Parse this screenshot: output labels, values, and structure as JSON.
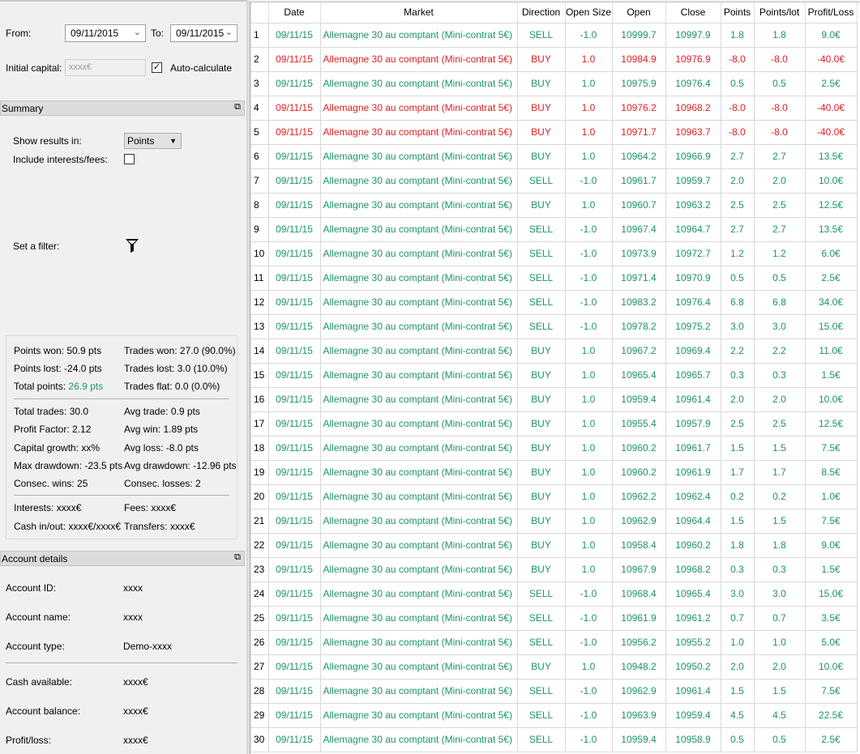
{
  "filters": {
    "from_label": "From:",
    "from_value": "09/11/2015",
    "to_label": "To:",
    "to_value": "09/11/2015",
    "initial_capital_label": "Initial capital:",
    "initial_capital_value": "xxxx€",
    "auto_calc_label": "Auto-calculate",
    "auto_calc_checked": true
  },
  "summary": {
    "title": "Summary",
    "show_results_label": "Show results in:",
    "show_results_value": "Points",
    "include_fees_label": "Include interests/fees:",
    "filter_label": "Set a filter:",
    "stats": {
      "points_won": "Points won: 50.9 pts",
      "trades_won": "Trades won: 27.0 (90.0%)",
      "points_lost": "Points lost: -24.0 pts",
      "trades_lost": "Trades lost: 3.0 (10.0%)",
      "total_points_label": "Total points:",
      "total_points_value": "26.9 pts",
      "trades_flat": "Trades flat: 0.0 (0.0%)",
      "total_trades": "Total trades: 30.0",
      "avg_trade": "Avg trade: 0.9 pts",
      "profit_factor": "Profit Factor: 2.12",
      "avg_win": "Avg win: 1.89 pts",
      "capital_growth": "Capital growth: xx%",
      "avg_loss": "Avg loss: -8.0 pts",
      "max_drawdown": "Max drawdown: -23.5 pts",
      "avg_drawdown": "Avg drawdown: -12.96 pts",
      "consec_wins": "Consec. wins: 25",
      "consec_losses": "Consec. losses: 2",
      "interests": "Interests: xxxx€",
      "fees": "Fees: xxxx€",
      "cash_inout": "Cash in/out: xxxx€/xxxx€",
      "transfers": "Transfers: xxxx€"
    }
  },
  "account": {
    "title": "Account details",
    "id_label": "Account ID:",
    "id_value": "xxxx",
    "name_label": "Account name:",
    "name_value": "xxxx",
    "type_label": "Account type:",
    "type_value": "Demo-xxxx",
    "cash_label": "Cash available:",
    "cash_value": "xxxx€",
    "balance_label": "Account balance:",
    "balance_value": "xxxx€",
    "pl_label": "Profit/loss:",
    "pl_value": "xxxx€"
  },
  "colors": {
    "win": "#1e9467",
    "loss": "#e02020"
  },
  "table": {
    "columns": [
      "",
      "Date",
      "Market",
      "Direction",
      "Open Size",
      "Open",
      "Close",
      "Points",
      "Points/lot",
      "Profit/Loss"
    ],
    "rows": [
      [
        "1",
        "09/11/15",
        "Allemagne 30 au comptant (Mini-contrat 5€)",
        "SELL",
        "-1.0",
        "10999.7",
        "10997.9",
        "1.8",
        "1.8",
        "9.0€",
        "win"
      ],
      [
        "2",
        "09/11/15",
        "Allemagne 30 au comptant (Mini-contrat 5€)",
        "BUY",
        "1.0",
        "10984.9",
        "10976.9",
        "-8.0",
        "-8.0",
        "-40.0€",
        "loss"
      ],
      [
        "3",
        "09/11/15",
        "Allemagne 30 au comptant (Mini-contrat 5€)",
        "BUY",
        "1.0",
        "10975.9",
        "10976.4",
        "0.5",
        "0.5",
        "2.5€",
        "win"
      ],
      [
        "4",
        "09/11/15",
        "Allemagne 30 au comptant (Mini-contrat 5€)",
        "BUY",
        "1.0",
        "10976.2",
        "10968.2",
        "-8.0",
        "-8.0",
        "-40.0€",
        "loss"
      ],
      [
        "5",
        "09/11/15",
        "Allemagne 30 au comptant (Mini-contrat 5€)",
        "BUY",
        "1.0",
        "10971.7",
        "10963.7",
        "-8.0",
        "-8.0",
        "-40.0€",
        "loss"
      ],
      [
        "6",
        "09/11/15",
        "Allemagne 30 au comptant (Mini-contrat 5€)",
        "BUY",
        "1.0",
        "10964.2",
        "10966.9",
        "2.7",
        "2.7",
        "13.5€",
        "win"
      ],
      [
        "7",
        "09/11/15",
        "Allemagne 30 au comptant (Mini-contrat 5€)",
        "SELL",
        "-1.0",
        "10961.7",
        "10959.7",
        "2.0",
        "2.0",
        "10.0€",
        "win"
      ],
      [
        "8",
        "09/11/15",
        "Allemagne 30 au comptant (Mini-contrat 5€)",
        "BUY",
        "1.0",
        "10960.7",
        "10963.2",
        "2.5",
        "2.5",
        "12.5€",
        "win"
      ],
      [
        "9",
        "09/11/15",
        "Allemagne 30 au comptant (Mini-contrat 5€)",
        "SELL",
        "-1.0",
        "10967.4",
        "10964.7",
        "2.7",
        "2.7",
        "13.5€",
        "win"
      ],
      [
        "10",
        "09/11/15",
        "Allemagne 30 au comptant (Mini-contrat 5€)",
        "SELL",
        "-1.0",
        "10973.9",
        "10972.7",
        "1.2",
        "1.2",
        "6.0€",
        "win"
      ],
      [
        "11",
        "09/11/15",
        "Allemagne 30 au comptant (Mini-contrat 5€)",
        "SELL",
        "-1.0",
        "10971.4",
        "10970.9",
        "0.5",
        "0.5",
        "2.5€",
        "win"
      ],
      [
        "12",
        "09/11/15",
        "Allemagne 30 au comptant (Mini-contrat 5€)",
        "SELL",
        "-1.0",
        "10983.2",
        "10976.4",
        "6.8",
        "6.8",
        "34.0€",
        "win"
      ],
      [
        "13",
        "09/11/15",
        "Allemagne 30 au comptant (Mini-contrat 5€)",
        "SELL",
        "-1.0",
        "10978.2",
        "10975.2",
        "3.0",
        "3.0",
        "15.0€",
        "win"
      ],
      [
        "14",
        "09/11/15",
        "Allemagne 30 au comptant (Mini-contrat 5€)",
        "BUY",
        "1.0",
        "10967.2",
        "10969.4",
        "2.2",
        "2.2",
        "11.0€",
        "win"
      ],
      [
        "15",
        "09/11/15",
        "Allemagne 30 au comptant (Mini-contrat 5€)",
        "BUY",
        "1.0",
        "10965.4",
        "10965.7",
        "0.3",
        "0.3",
        "1.5€",
        "win"
      ],
      [
        "16",
        "09/11/15",
        "Allemagne 30 au comptant (Mini-contrat 5€)",
        "BUY",
        "1.0",
        "10959.4",
        "10961.4",
        "2.0",
        "2.0",
        "10.0€",
        "win"
      ],
      [
        "17",
        "09/11/15",
        "Allemagne 30 au comptant (Mini-contrat 5€)",
        "BUY",
        "1.0",
        "10955.4",
        "10957.9",
        "2.5",
        "2.5",
        "12.5€",
        "win"
      ],
      [
        "18",
        "09/11/15",
        "Allemagne 30 au comptant (Mini-contrat 5€)",
        "BUY",
        "1.0",
        "10960.2",
        "10961.7",
        "1.5",
        "1.5",
        "7.5€",
        "win"
      ],
      [
        "19",
        "09/11/15",
        "Allemagne 30 au comptant (Mini-contrat 5€)",
        "BUY",
        "1.0",
        "10960.2",
        "10961.9",
        "1.7",
        "1.7",
        "8.5€",
        "win"
      ],
      [
        "20",
        "09/11/15",
        "Allemagne 30 au comptant (Mini-contrat 5€)",
        "BUY",
        "1.0",
        "10962.2",
        "10962.4",
        "0.2",
        "0.2",
        "1.0€",
        "win"
      ],
      [
        "21",
        "09/11/15",
        "Allemagne 30 au comptant (Mini-contrat 5€)",
        "BUY",
        "1.0",
        "10962.9",
        "10964.4",
        "1.5",
        "1.5",
        "7.5€",
        "win"
      ],
      [
        "22",
        "09/11/15",
        "Allemagne 30 au comptant (Mini-contrat 5€)",
        "BUY",
        "1.0",
        "10958.4",
        "10960.2",
        "1.8",
        "1.8",
        "9.0€",
        "win"
      ],
      [
        "23",
        "09/11/15",
        "Allemagne 30 au comptant (Mini-contrat 5€)",
        "BUY",
        "1.0",
        "10967.9",
        "10968.2",
        "0.3",
        "0.3",
        "1.5€",
        "win"
      ],
      [
        "24",
        "09/11/15",
        "Allemagne 30 au comptant (Mini-contrat 5€)",
        "SELL",
        "-1.0",
        "10968.4",
        "10965.4",
        "3.0",
        "3.0",
        "15.0€",
        "win"
      ],
      [
        "25",
        "09/11/15",
        "Allemagne 30 au comptant (Mini-contrat 5€)",
        "SELL",
        "-1.0",
        "10961.9",
        "10961.2",
        "0.7",
        "0.7",
        "3.5€",
        "win"
      ],
      [
        "26",
        "09/11/15",
        "Allemagne 30 au comptant (Mini-contrat 5€)",
        "SELL",
        "-1.0",
        "10956.2",
        "10955.2",
        "1.0",
        "1.0",
        "5.0€",
        "win"
      ],
      [
        "27",
        "09/11/15",
        "Allemagne 30 au comptant (Mini-contrat 5€)",
        "BUY",
        "1.0",
        "10948.2",
        "10950.2",
        "2.0",
        "2.0",
        "10.0€",
        "win"
      ],
      [
        "28",
        "09/11/15",
        "Allemagne 30 au comptant (Mini-contrat 5€)",
        "SELL",
        "-1.0",
        "10962.9",
        "10961.4",
        "1.5",
        "1.5",
        "7.5€",
        "win"
      ],
      [
        "29",
        "09/11/15",
        "Allemagne 30 au comptant (Mini-contrat 5€)",
        "SELL",
        "-1.0",
        "10963.9",
        "10959.4",
        "4.5",
        "4.5",
        "22.5€",
        "win"
      ],
      [
        "30",
        "09/11/15",
        "Allemagne 30 au comptant (Mini-contrat 5€)",
        "SELL",
        "-1.0",
        "10959.4",
        "10958.9",
        "0.5",
        "0.5",
        "2.5€",
        "win"
      ]
    ]
  }
}
